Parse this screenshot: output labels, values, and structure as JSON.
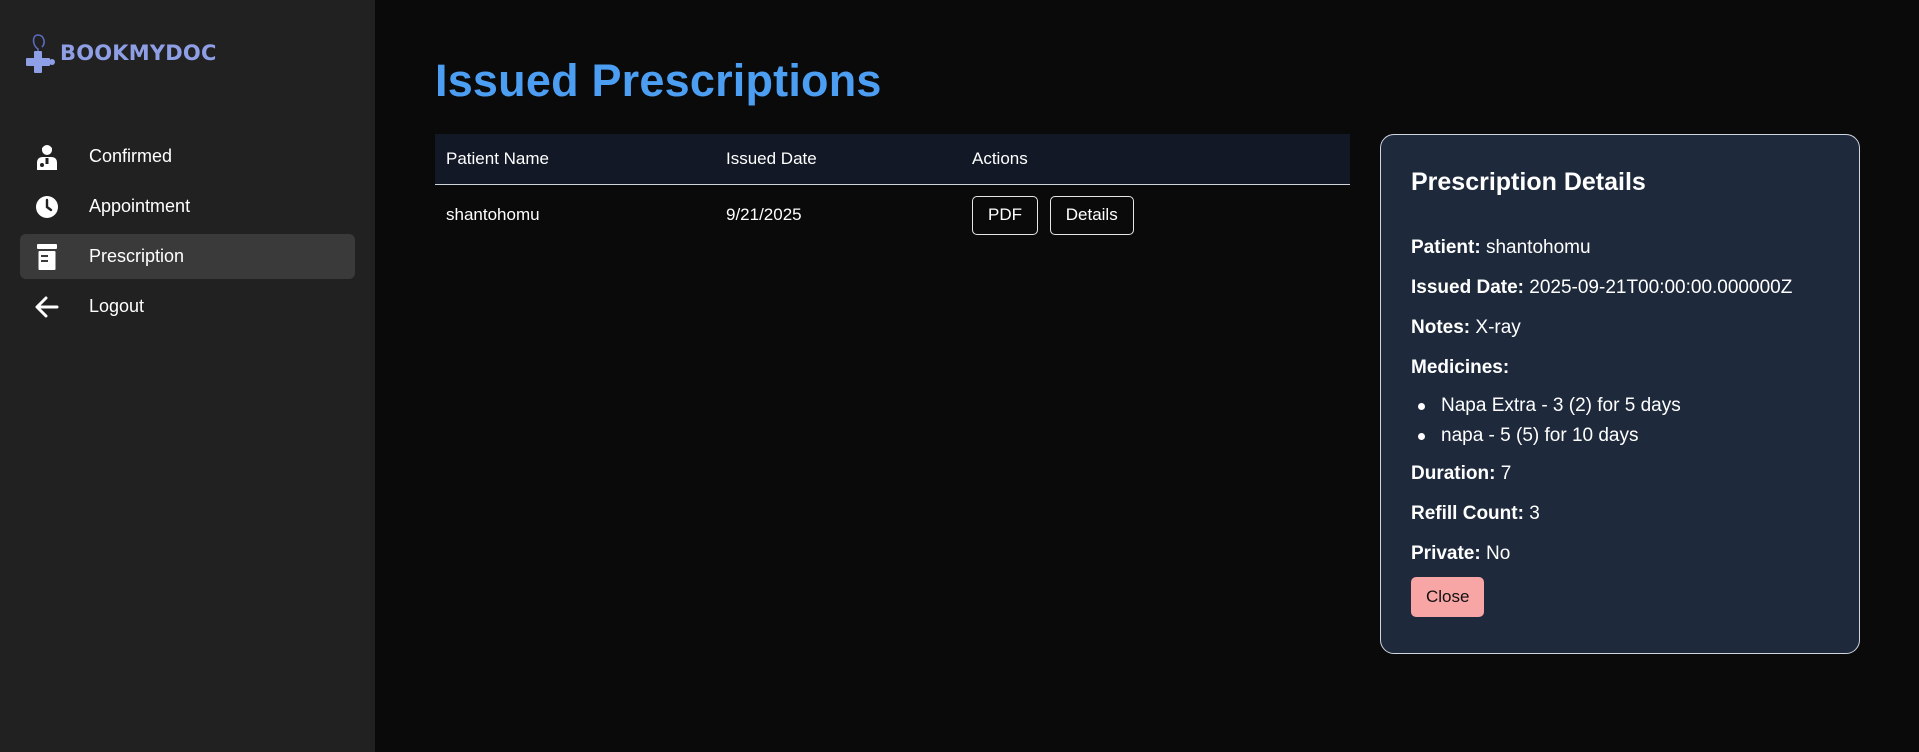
{
  "app": {
    "logo_text": "BOOKMYDOC",
    "brand_color": "#8f9fe6"
  },
  "sidebar": {
    "items": [
      {
        "label": "Confirmed",
        "icon": "doctor-icon",
        "active": false
      },
      {
        "label": "Appointment",
        "icon": "clock-icon",
        "active": false
      },
      {
        "label": "Prescription",
        "icon": "prescription-icon",
        "active": true
      },
      {
        "label": "Logout",
        "icon": "arrow-left-icon",
        "active": false
      }
    ]
  },
  "main": {
    "title": "Issued Prescriptions",
    "title_color": "#4b9ef2",
    "table": {
      "columns": [
        "Patient Name",
        "Issued Date",
        "Actions"
      ],
      "rows": [
        {
          "patient": "shantohomu",
          "date": "9/21/2025",
          "actions": [
            "PDF",
            "Details"
          ]
        }
      ]
    }
  },
  "details": {
    "title": "Prescription Details",
    "patient_label": "Patient:",
    "patient": "shantohomu",
    "issued_label": "Issued Date:",
    "issued": "2025-09-21T00:00:00.000000Z",
    "notes_label": "Notes:",
    "notes": "X-ray",
    "medicines_label": "Medicines:",
    "medicines": [
      "Napa Extra - 3 (2) for 5 days",
      "napa - 5 (5) for 10 days"
    ],
    "duration_label": "Duration:",
    "duration": "7",
    "refill_label": "Refill Count:",
    "refill": "3",
    "private_label": "Private:",
    "private": "No",
    "close_label": "Close",
    "close_color": "#f8a5a5"
  }
}
